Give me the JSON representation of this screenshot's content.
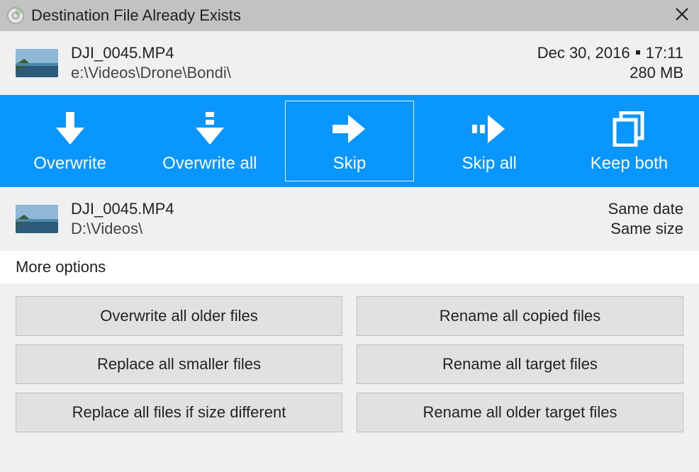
{
  "window": {
    "title": "Destination File Already Exists"
  },
  "source": {
    "filename": "DJI_0045.MP4",
    "path": "e:\\Videos\\Drone\\Bondi\\",
    "date": "Dec 30, 2016",
    "time": "17:11",
    "size": "280 MB"
  },
  "destination": {
    "filename": "DJI_0045.MP4",
    "path": "D:\\Videos\\",
    "date_compare": "Same date",
    "size_compare": "Same size"
  },
  "actions": {
    "overwrite": "Overwrite",
    "overwrite_all": "Overwrite all",
    "skip": "Skip",
    "skip_all": "Skip all",
    "keep_both": "Keep both"
  },
  "more": {
    "header": "More options"
  },
  "options": {
    "overwrite_older": "Overwrite all older files",
    "rename_copied": "Rename all copied files",
    "replace_smaller": "Replace all smaller files",
    "rename_target": "Rename all target files",
    "replace_diff_size": "Replace all files if size different",
    "rename_older_target": "Rename all older target files"
  }
}
